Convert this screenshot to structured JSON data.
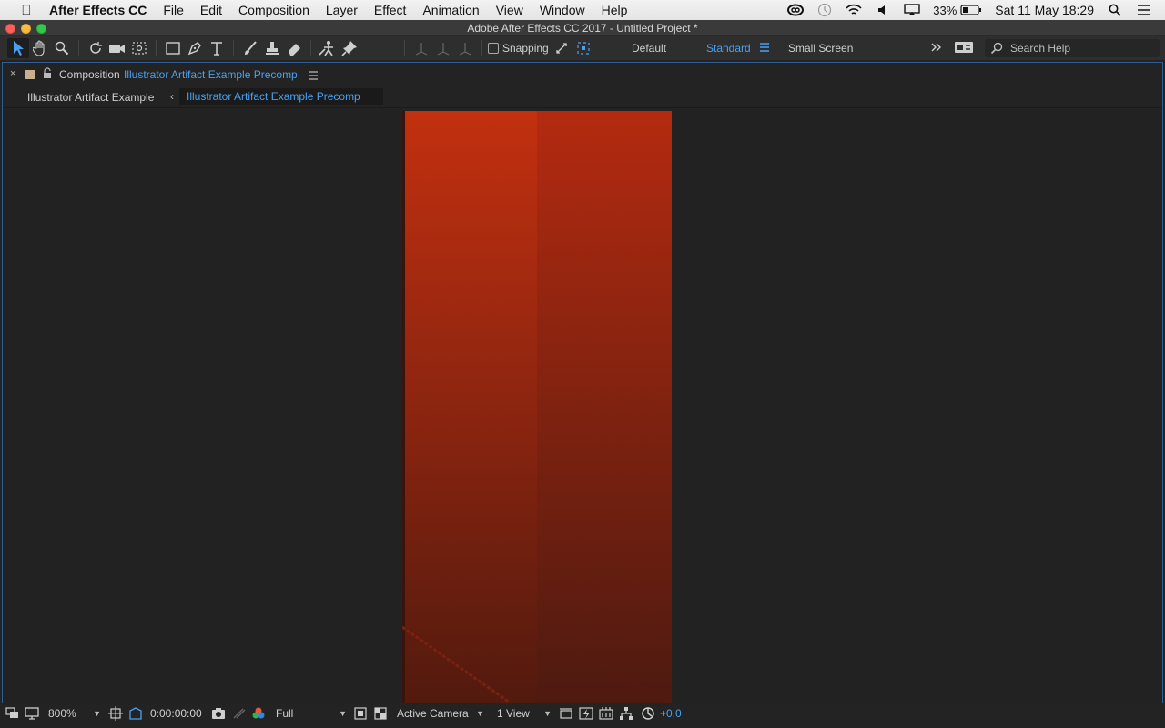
{
  "menubar": {
    "app_name": "After Effects CC",
    "menus": [
      "File",
      "Edit",
      "Composition",
      "Layer",
      "Effect",
      "Animation",
      "View",
      "Window",
      "Help"
    ],
    "battery": "33%",
    "datetime": "Sat 11 May  18:29"
  },
  "window": {
    "title": "Adobe After Effects CC 2017 - Untitled Project *"
  },
  "toolbar": {
    "snapping_label": "Snapping",
    "workspaces": [
      "Default",
      "Standard",
      "Small Screen"
    ],
    "active_workspace": "Standard",
    "search_placeholder": "Search Help"
  },
  "panel": {
    "tab_prefix": "Composition",
    "tab_name": "Illustrator Artifact Example Precomp",
    "breadcrumbs": [
      "Illustrator Artifact Example",
      "Illustrator Artifact Example Precomp"
    ]
  },
  "viewer_footer": {
    "zoom": "800%",
    "timecode": "0:00:00:00",
    "resolution": "Full",
    "camera": "Active Camera",
    "views": "1 View",
    "exposure": "+0,0"
  },
  "colors": {
    "accent": "#4aa0f0",
    "panel_border": "#2f5f92",
    "art_top": "#c2300f",
    "art_bottom": "#4e1a10"
  }
}
